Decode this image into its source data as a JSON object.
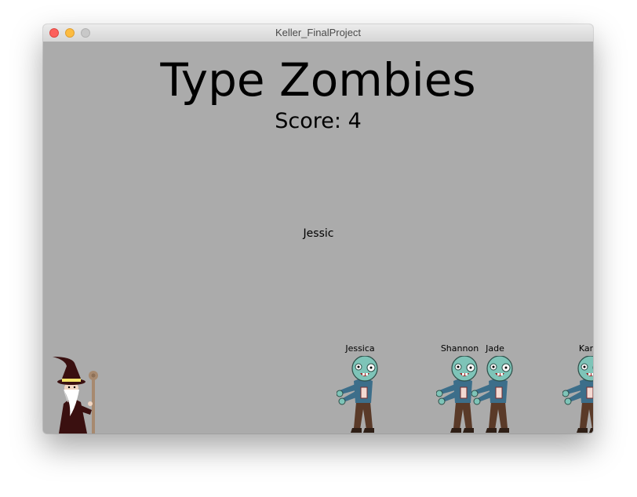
{
  "window": {
    "title": "Keller_FinalProject"
  },
  "game": {
    "title": "Type Zombies",
    "score_label": "Score:",
    "score": 4,
    "typed_text": "Jessic",
    "zombies": [
      {
        "name": "Jessica"
      },
      {
        "name": "Shannon"
      },
      {
        "name": "Jade"
      },
      {
        "name": "Kar"
      }
    ]
  },
  "colors": {
    "background": "#ababab",
    "zombie_skin": "#7ec4b8",
    "zombie_shirt": "#3c6e8a",
    "zombie_pants": "#5a3a28",
    "wizard_robe": "#3a1010"
  }
}
